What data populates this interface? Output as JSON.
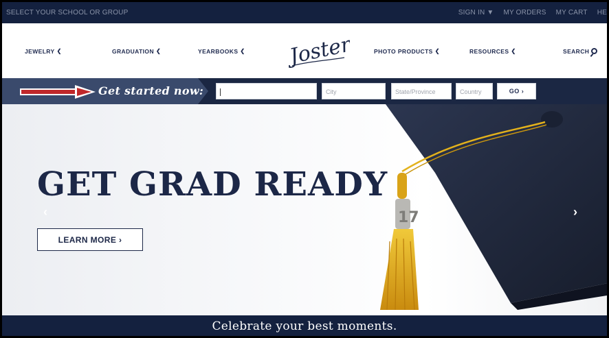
{
  "topbar": {
    "school_label": "SELECT YOUR SCHOOL OR GROUP",
    "links": [
      "SIGN IN",
      "MY ORDERS",
      "MY CART",
      "HE"
    ]
  },
  "nav": {
    "items": [
      {
        "label": "JEWELRY"
      },
      {
        "label": "GRADUATION"
      },
      {
        "label": "YEARBOOKS"
      },
      {
        "label": "PHOTO PRODUCTS"
      },
      {
        "label": "RESOURCES"
      }
    ],
    "search_label": "SEARCH",
    "logo_text": "Jostens"
  },
  "startbar": {
    "label": "Get started now:",
    "school_value": "",
    "city_placeholder": "City",
    "state_placeholder": "State/Province",
    "country_placeholder": "Country",
    "go_label": "GO"
  },
  "hero": {
    "title": "GET GRAD READY",
    "button_label": "LEARN MORE",
    "prev_icon": "chevron-left-icon",
    "next_icon": "chevron-right-icon"
  },
  "bottom": {
    "tagline": "Celebrate your best moments."
  },
  "colors": {
    "navy": "#14213f",
    "brand_text": "#1c2747",
    "arrow_red": "#c0282a",
    "tassel_gold": "#e3b21c"
  }
}
